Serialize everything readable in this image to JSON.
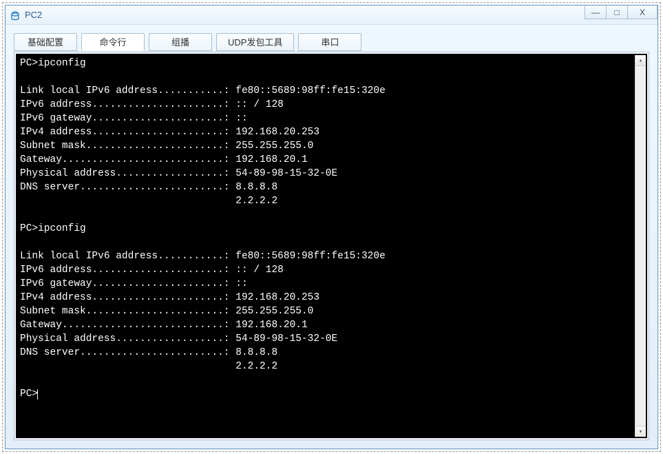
{
  "window": {
    "title": "PC2",
    "controls": {
      "min": "—",
      "max": "□",
      "close": "X"
    }
  },
  "tabs": {
    "items": [
      {
        "label": "基础配置"
      },
      {
        "label": "命令行"
      },
      {
        "label": "组播"
      },
      {
        "label": "UDP发包工具"
      },
      {
        "label": "串口"
      }
    ],
    "active_index": 1
  },
  "scroll": {
    "up_glyph": "▴",
    "down_glyph": "▾"
  },
  "terminal": {
    "prompt": "PC>",
    "command": "ipconfig",
    "blocks": [
      {
        "prompt": "PC>ipconfig",
        "lines": [
          "Link local IPv6 address...........: fe80::5689:98ff:fe15:320e",
          "IPv6 address......................: :: / 128",
          "IPv6 gateway......................: ::",
          "IPv4 address......................: 192.168.20.253",
          "Subnet mask.......................: 255.255.255.0",
          "Gateway...........................: 192.168.20.1",
          "Physical address..................: 54-89-98-15-32-0E",
          "DNS server........................: 8.8.8.8",
          "                                    2.2.2.2"
        ]
      },
      {
        "prompt": "PC>ipconfig",
        "lines": [
          "Link local IPv6 address...........: fe80::5689:98ff:fe15:320e",
          "IPv6 address......................: :: / 128",
          "IPv6 gateway......................: ::",
          "IPv4 address......................: 192.168.20.253",
          "Subnet mask.......................: 255.255.255.0",
          "Gateway...........................: 192.168.20.1",
          "Physical address..................: 54-89-98-15-32-0E",
          "DNS server........................: 8.8.8.8",
          "                                    2.2.2.2"
        ]
      }
    ],
    "final_prompt": "PC>"
  },
  "ipconfig": {
    "link_local_ipv6": "fe80::5689:98ff:fe15:320e",
    "ipv6_address": ":: / 128",
    "ipv6_gateway": "::",
    "ipv4_address": "192.168.20.253",
    "subnet_mask": "255.255.255.0",
    "gateway": "192.168.20.1",
    "physical_address": "54-89-98-15-32-0E",
    "dns_servers": [
      "8.8.8.8",
      "2.2.2.2"
    ]
  },
  "colors": {
    "title_text": "#2b5f8e",
    "border": "#a8bed3",
    "bg_light": "#eaf4fb",
    "terminal_bg": "#000000",
    "terminal_fg": "#ffffff"
  }
}
